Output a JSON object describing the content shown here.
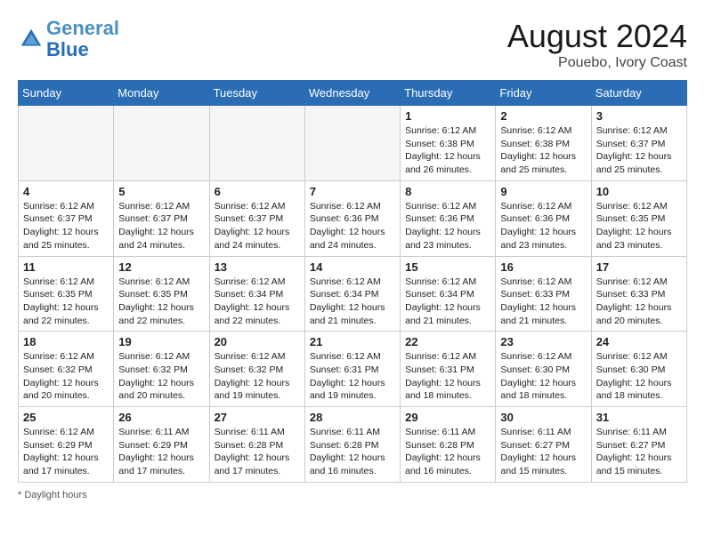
{
  "header": {
    "logo_line1": "General",
    "logo_line2": "Blue",
    "month_year": "August 2024",
    "location": "Pouebo, Ivory Coast"
  },
  "days_of_week": [
    "Sunday",
    "Monday",
    "Tuesday",
    "Wednesday",
    "Thursday",
    "Friday",
    "Saturday"
  ],
  "weeks": [
    [
      {
        "day": "",
        "info": ""
      },
      {
        "day": "",
        "info": ""
      },
      {
        "day": "",
        "info": ""
      },
      {
        "day": "",
        "info": ""
      },
      {
        "day": "1",
        "info": "Sunrise: 6:12 AM\nSunset: 6:38 PM\nDaylight: 12 hours\nand 26 minutes."
      },
      {
        "day": "2",
        "info": "Sunrise: 6:12 AM\nSunset: 6:38 PM\nDaylight: 12 hours\nand 25 minutes."
      },
      {
        "day": "3",
        "info": "Sunrise: 6:12 AM\nSunset: 6:37 PM\nDaylight: 12 hours\nand 25 minutes."
      }
    ],
    [
      {
        "day": "4",
        "info": "Sunrise: 6:12 AM\nSunset: 6:37 PM\nDaylight: 12 hours\nand 25 minutes."
      },
      {
        "day": "5",
        "info": "Sunrise: 6:12 AM\nSunset: 6:37 PM\nDaylight: 12 hours\nand 24 minutes."
      },
      {
        "day": "6",
        "info": "Sunrise: 6:12 AM\nSunset: 6:37 PM\nDaylight: 12 hours\nand 24 minutes."
      },
      {
        "day": "7",
        "info": "Sunrise: 6:12 AM\nSunset: 6:36 PM\nDaylight: 12 hours\nand 24 minutes."
      },
      {
        "day": "8",
        "info": "Sunrise: 6:12 AM\nSunset: 6:36 PM\nDaylight: 12 hours\nand 23 minutes."
      },
      {
        "day": "9",
        "info": "Sunrise: 6:12 AM\nSunset: 6:36 PM\nDaylight: 12 hours\nand 23 minutes."
      },
      {
        "day": "10",
        "info": "Sunrise: 6:12 AM\nSunset: 6:35 PM\nDaylight: 12 hours\nand 23 minutes."
      }
    ],
    [
      {
        "day": "11",
        "info": "Sunrise: 6:12 AM\nSunset: 6:35 PM\nDaylight: 12 hours\nand 22 minutes."
      },
      {
        "day": "12",
        "info": "Sunrise: 6:12 AM\nSunset: 6:35 PM\nDaylight: 12 hours\nand 22 minutes."
      },
      {
        "day": "13",
        "info": "Sunrise: 6:12 AM\nSunset: 6:34 PM\nDaylight: 12 hours\nand 22 minutes."
      },
      {
        "day": "14",
        "info": "Sunrise: 6:12 AM\nSunset: 6:34 PM\nDaylight: 12 hours\nand 21 minutes."
      },
      {
        "day": "15",
        "info": "Sunrise: 6:12 AM\nSunset: 6:34 PM\nDaylight: 12 hours\nand 21 minutes."
      },
      {
        "day": "16",
        "info": "Sunrise: 6:12 AM\nSunset: 6:33 PM\nDaylight: 12 hours\nand 21 minutes."
      },
      {
        "day": "17",
        "info": "Sunrise: 6:12 AM\nSunset: 6:33 PM\nDaylight: 12 hours\nand 20 minutes."
      }
    ],
    [
      {
        "day": "18",
        "info": "Sunrise: 6:12 AM\nSunset: 6:32 PM\nDaylight: 12 hours\nand 20 minutes."
      },
      {
        "day": "19",
        "info": "Sunrise: 6:12 AM\nSunset: 6:32 PM\nDaylight: 12 hours\nand 20 minutes."
      },
      {
        "day": "20",
        "info": "Sunrise: 6:12 AM\nSunset: 6:32 PM\nDaylight: 12 hours\nand 19 minutes."
      },
      {
        "day": "21",
        "info": "Sunrise: 6:12 AM\nSunset: 6:31 PM\nDaylight: 12 hours\nand 19 minutes."
      },
      {
        "day": "22",
        "info": "Sunrise: 6:12 AM\nSunset: 6:31 PM\nDaylight: 12 hours\nand 18 minutes."
      },
      {
        "day": "23",
        "info": "Sunrise: 6:12 AM\nSunset: 6:30 PM\nDaylight: 12 hours\nand 18 minutes."
      },
      {
        "day": "24",
        "info": "Sunrise: 6:12 AM\nSunset: 6:30 PM\nDaylight: 12 hours\nand 18 minutes."
      }
    ],
    [
      {
        "day": "25",
        "info": "Sunrise: 6:12 AM\nSunset: 6:29 PM\nDaylight: 12 hours\nand 17 minutes."
      },
      {
        "day": "26",
        "info": "Sunrise: 6:11 AM\nSunset: 6:29 PM\nDaylight: 12 hours\nand 17 minutes."
      },
      {
        "day": "27",
        "info": "Sunrise: 6:11 AM\nSunset: 6:28 PM\nDaylight: 12 hours\nand 17 minutes."
      },
      {
        "day": "28",
        "info": "Sunrise: 6:11 AM\nSunset: 6:28 PM\nDaylight: 12 hours\nand 16 minutes."
      },
      {
        "day": "29",
        "info": "Sunrise: 6:11 AM\nSunset: 6:28 PM\nDaylight: 12 hours\nand 16 minutes."
      },
      {
        "day": "30",
        "info": "Sunrise: 6:11 AM\nSunset: 6:27 PM\nDaylight: 12 hours\nand 15 minutes."
      },
      {
        "day": "31",
        "info": "Sunrise: 6:11 AM\nSunset: 6:27 PM\nDaylight: 12 hours\nand 15 minutes."
      }
    ]
  ],
  "footer": "Daylight hours"
}
